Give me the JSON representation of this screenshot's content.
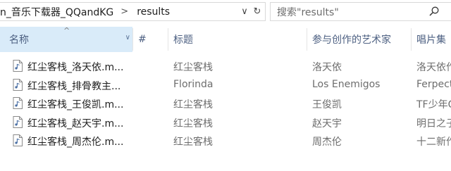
{
  "address": {
    "crumbs": [
      "n_音乐下载器_QQandKG",
      "results"
    ],
    "separator": ">",
    "dropdown": "∨",
    "refresh": "↻"
  },
  "search": {
    "placeholder": "搜索\"results\""
  },
  "columns": {
    "name": "名称",
    "number": "#",
    "title": "标题",
    "artist": "参与创作的艺术家",
    "album": "唱片集",
    "sort_indicator": "^",
    "name_dropdown": "∨"
  },
  "files": [
    {
      "name": "红尘客栈_洛天依.m...",
      "title": "红尘客栈",
      "artist": "洛天依",
      "album": "洛天依作"
    },
    {
      "name": "红尘客栈_排骨教主...",
      "title": "Florinda",
      "artist": "Los Enemigos",
      "album": "Ferpect"
    },
    {
      "name": "红尘客栈_王俊凯.m...",
      "title": "红尘客栈",
      "artist": "王俊凯",
      "album": "TF少年G"
    },
    {
      "name": "红尘客栈_赵天宇.m...",
      "title": "红尘客栈",
      "artist": "赵天宇",
      "album": "明日之子"
    },
    {
      "name": "红尘客栈_周杰伦.m...",
      "title": "红尘客栈",
      "artist": "周杰伦",
      "album": "十二新作"
    }
  ]
}
